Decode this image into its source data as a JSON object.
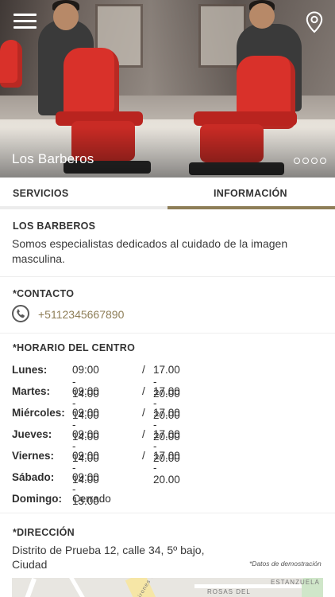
{
  "hero": {
    "title": "Los Barberos",
    "slides": 4,
    "active_slide": 0
  },
  "icons": {
    "menu": "hamburger-menu-icon",
    "location": "map-pin-icon",
    "phone": "phone-icon"
  },
  "tabs": [
    {
      "label": "SERVICIOS",
      "active": false
    },
    {
      "label": "INFORMACIÓN",
      "active": true
    }
  ],
  "about": {
    "heading": "LOS BARBEROS",
    "text_line1": "Somos especialistas dedicados al cuidado de la imagen",
    "text_line2": "masculina."
  },
  "contact": {
    "heading": "*CONTACTO",
    "phone": "+5112345667890"
  },
  "hours": {
    "heading": "*HORARIO DEL CENTRO",
    "rows": [
      {
        "day": "Lunes:",
        "t1": "09:00 - 14.00",
        "sep": "/",
        "t2": "17.00 - 20.00"
      },
      {
        "day": "Martes:",
        "t1": "09:00 - 14.00",
        "sep": "/",
        "t2": "17.00 - 20.00"
      },
      {
        "day": "Miércoles:",
        "t1": "09:00 - 14.00",
        "sep": "/",
        "t2": "17.00 - 20.00"
      },
      {
        "day": "Jueves:",
        "t1": "09:00 - 14.00",
        "sep": "/",
        "t2": "17.00 - 20.00"
      },
      {
        "day": "Viernes:",
        "t1": "09:00 - 14.00",
        "sep": "/",
        "t2": "17.00 - 20.00"
      },
      {
        "day": "Sábado:",
        "t1": "09:00 - 15.00",
        "sep": "",
        "t2": ""
      },
      {
        "day": "Domingo:",
        "t1": "Cerrado",
        "sep": "",
        "t2": ""
      }
    ]
  },
  "address": {
    "heading": "*DIRECCIÓN",
    "line1": "Distrito de Prueba 12, calle 34, 5º bajo,",
    "line2": "Ciudad",
    "demo_note": "*Datos de demostración"
  },
  "map": {
    "labels": [
      "ESTANZUELA",
      "ROSAS DEL",
      "Jirones Nv"
    ]
  },
  "colors": {
    "accent": "#8e7e57",
    "tab_inactive_bar": "#ececec",
    "chair_red": "#d9312a"
  }
}
